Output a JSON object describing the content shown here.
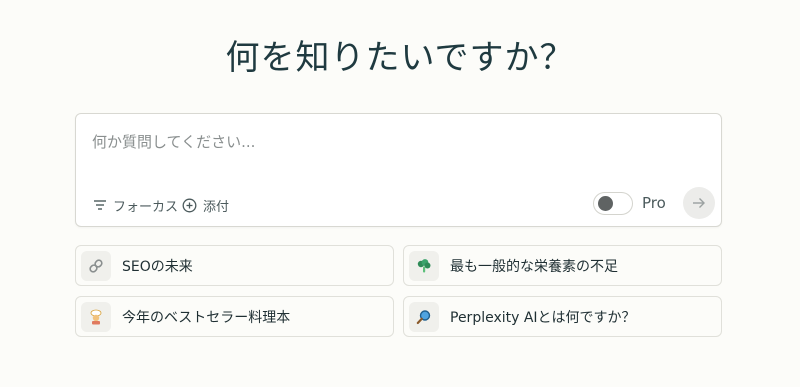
{
  "heading": "何を知りたいですか？",
  "search": {
    "placeholder": "何か質問してください...",
    "value": ""
  },
  "toolbar": {
    "focus_label": "フォーカス",
    "attach_label": "添付",
    "pro_label": "Pro",
    "pro_enabled": false
  },
  "suggestions": [
    {
      "icon": "link-icon",
      "label": "SEOの未来"
    },
    {
      "icon": "broccoli-icon",
      "label": "最も一般的な栄養素の不足"
    },
    {
      "icon": "book-chef-icon",
      "label": "今年のベストセラー料理本"
    },
    {
      "icon": "magnifier-icon",
      "label": "Perplexity AIとは何ですか？"
    }
  ],
  "colors": {
    "background": "#fcfcf9",
    "text": "#13343b",
    "border": "#d8d8d2",
    "toggle_knob": "#5f6363"
  }
}
